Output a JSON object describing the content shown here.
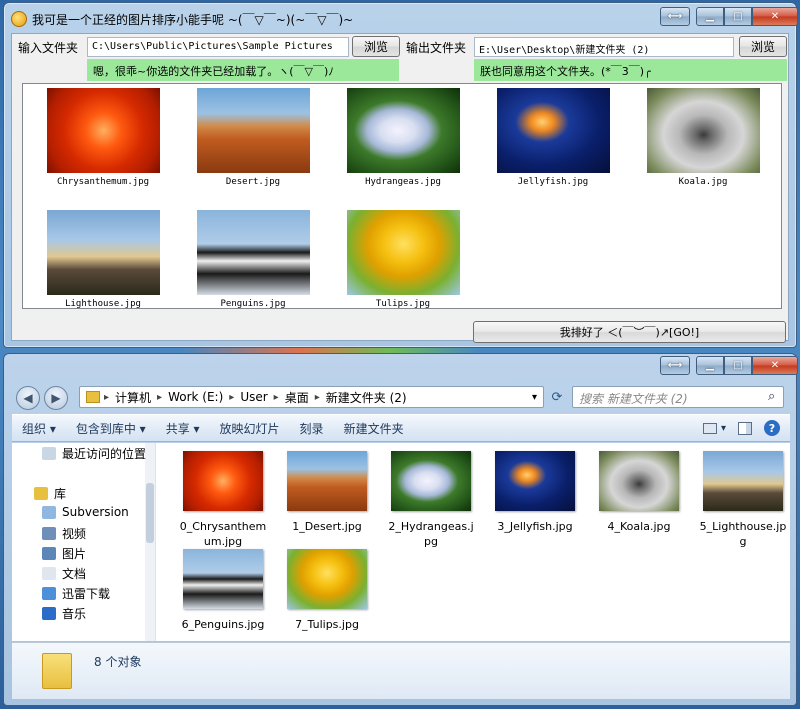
{
  "sorter": {
    "title": "我可是一个正经的图片排序小能手呢 ~(￣▽￣~)(~￣▽￣)~",
    "input_label": "输入文件夹",
    "input_path": "C:\\Users\\Public\\Pictures\\Sample Pictures",
    "browse_input": "浏览",
    "output_label": "输出文件夹",
    "output_path": "E:\\User\\Desktop\\新建文件夹 (2)",
    "browse_output": "浏览",
    "status_input": "嗯，很乖~你选的文件夹已经加载了。ヽ(￣▽￣)ﾉ",
    "status_output": "朕也同意用这个文件夹。(*￣3￣)╭",
    "images": [
      {
        "name": "Chrysanthemum.jpg",
        "pic": "pic-chrysanthemum"
      },
      {
        "name": "Desert.jpg",
        "pic": "pic-desert"
      },
      {
        "name": "Hydrangeas.jpg",
        "pic": "pic-hydrangeas"
      },
      {
        "name": "Jellyfish.jpg",
        "pic": "pic-jellyfish"
      },
      {
        "name": "Koala.jpg",
        "pic": "pic-koala"
      },
      {
        "name": "Lighthouse.jpg",
        "pic": "pic-lighthouse"
      },
      {
        "name": "Penguins.jpg",
        "pic": "pic-penguins"
      },
      {
        "name": "Tulips.jpg",
        "pic": "pic-tulips"
      }
    ],
    "sort_button": "我排好了 ＜(￣︶￣)↗[GO!]"
  },
  "explorer": {
    "breadcrumb": [
      "计算机",
      "Work (E:)",
      "User",
      "桌面",
      "新建文件夹 (2)"
    ],
    "search_placeholder": "搜索 新建文件夹 (2)",
    "toolbar": [
      "组织 ▾",
      "包含到库中 ▾",
      "共享 ▾",
      "放映幻灯片",
      "刻录",
      "新建文件夹"
    ],
    "nav": [
      {
        "label": "最近访问的位置",
        "icon": "recent-places-icon"
      },
      {
        "label": "库",
        "icon": "library-icon"
      },
      {
        "label": "Subversion",
        "icon": "subversion-icon"
      },
      {
        "label": "视频",
        "icon": "videos-icon"
      },
      {
        "label": "图片",
        "icon": "pictures-icon"
      },
      {
        "label": "文档",
        "icon": "documents-icon"
      },
      {
        "label": "迅雷下载",
        "icon": "thunder-download-icon"
      },
      {
        "label": "音乐",
        "icon": "music-icon"
      }
    ],
    "files": [
      {
        "name": "0_Chrysanthemum.jpg",
        "pic": "pic-chrysanthemum"
      },
      {
        "name": "1_Desert.jpg",
        "pic": "pic-desert"
      },
      {
        "name": "2_Hydrangeas.jpg",
        "pic": "pic-hydrangeas"
      },
      {
        "name": "3_Jellyfish.jpg",
        "pic": "pic-jellyfish"
      },
      {
        "name": "4_Koala.jpg",
        "pic": "pic-koala"
      },
      {
        "name": "5_Lighthouse.jpg",
        "pic": "pic-lighthouse"
      },
      {
        "name": "6_Penguins.jpg",
        "pic": "pic-penguins"
      },
      {
        "name": "7_Tulips.jpg",
        "pic": "pic-tulips"
      }
    ],
    "item_count": "8 个对象"
  },
  "colors": {
    "status_green": "#9be89b",
    "close_red": "#c4391f"
  }
}
